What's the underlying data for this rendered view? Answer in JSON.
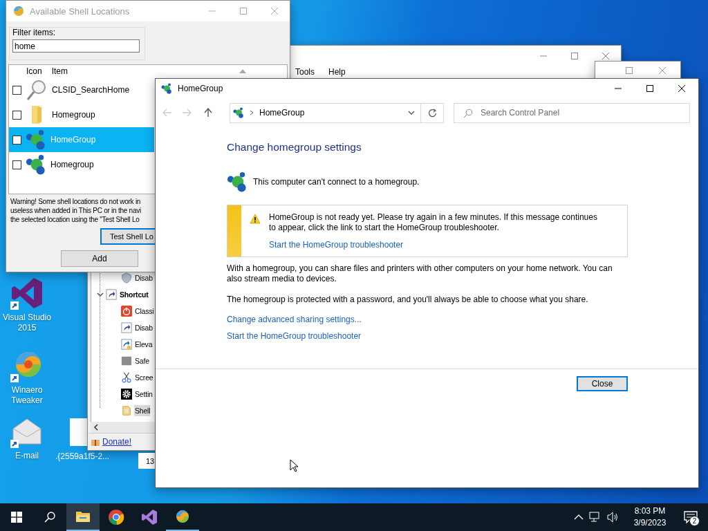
{
  "desktop": {
    "icons": [
      {
        "kind": "vs",
        "label": "Visual Studio 2015"
      },
      {
        "kind": "winaero",
        "label": "Winaero Tweaker"
      },
      {
        "kind": "email",
        "label": "E-mail"
      }
    ],
    "file_label": ".{2559a1f5-2..."
  },
  "tweaker_window": {
    "cut_group": [
      {
        "label": "Disab",
        "kind": "shield",
        "selected": false
      }
    ],
    "groups": [
      {
        "label": "Shortcut",
        "kind": "shortcut",
        "expanded": true,
        "selected": false,
        "children": [
          {
            "label": "Classi",
            "kind": "power",
            "selected": false
          },
          {
            "label": "Disab",
            "kind": "shortcut",
            "selected": false
          },
          {
            "label": "Eleva",
            "kind": "elevated",
            "selected": false
          },
          {
            "label": "Safe",
            "kind": "grey",
            "selected": false
          },
          {
            "label": "Scree",
            "kind": "scissors",
            "selected": false
          },
          {
            "label": "Settin",
            "kind": "gear",
            "selected": false
          },
          {
            "label": "Shell",
            "kind": "shell",
            "selected": true
          }
        ]
      }
    ],
    "donate_link": "Donate!"
  },
  "side_box": {
    "value": "13"
  },
  "back_window": {
    "menu": [
      "Tools",
      "Help"
    ]
  },
  "shell_locations": {
    "title": "Available Shell Locations",
    "filter_label": "Filter items:",
    "filter_value": "home",
    "columns": [
      "Icon",
      "Item"
    ],
    "rows": [
      {
        "kind": "search",
        "label": "CLSID_SearchHome",
        "checked": false,
        "selected": false
      },
      {
        "kind": "folder",
        "label": "Homegroup",
        "checked": false,
        "selected": false
      },
      {
        "kind": "homegroup",
        "label": "HomeGroup",
        "checked": false,
        "selected": true
      },
      {
        "kind": "homegroup",
        "label": "Homegroup",
        "checked": false,
        "selected": false
      }
    ],
    "warning_lines": [
      "Warning! Some shell locations do not work in",
      "useless when added in This PC or in the navi",
      "the selected location using the \"Test Shell Lo"
    ],
    "test_button": "Test Shell Lo",
    "add_button": "Add"
  },
  "homegroup": {
    "title": "HomeGroup",
    "address": "HomeGroup",
    "search_placeholder": "Search Control Panel",
    "heading": "Change homegroup settings",
    "status": "This computer can't connect to a homegroup.",
    "notice": {
      "text": "HomeGroup is not ready yet. Please try again in a few minutes. If this message continues to appear, click the link to start the HomeGroup troubleshooter.",
      "link": "Start the HomeGroup troubleshooter"
    },
    "paragraphs": [
      "With a homegroup, you can share files and printers with other computers on your home network. You can also stream media to devices.",
      "The homegroup is protected with a password, and you'll always be able to choose what you share."
    ],
    "links": [
      "Change advanced sharing settings...",
      "Start the HomeGroup troubleshooter"
    ],
    "close_button": "Close"
  },
  "taskbar": {
    "apps": [
      {
        "kind": "explorer",
        "active": true,
        "running": true
      },
      {
        "kind": "chrome",
        "active": false,
        "running": false
      },
      {
        "kind": "vs",
        "active": false,
        "running": false
      },
      {
        "kind": "winaero",
        "active": false,
        "running": true
      }
    ],
    "time": "8:03 PM",
    "date": "3/9/2023",
    "notifications": "2"
  }
}
